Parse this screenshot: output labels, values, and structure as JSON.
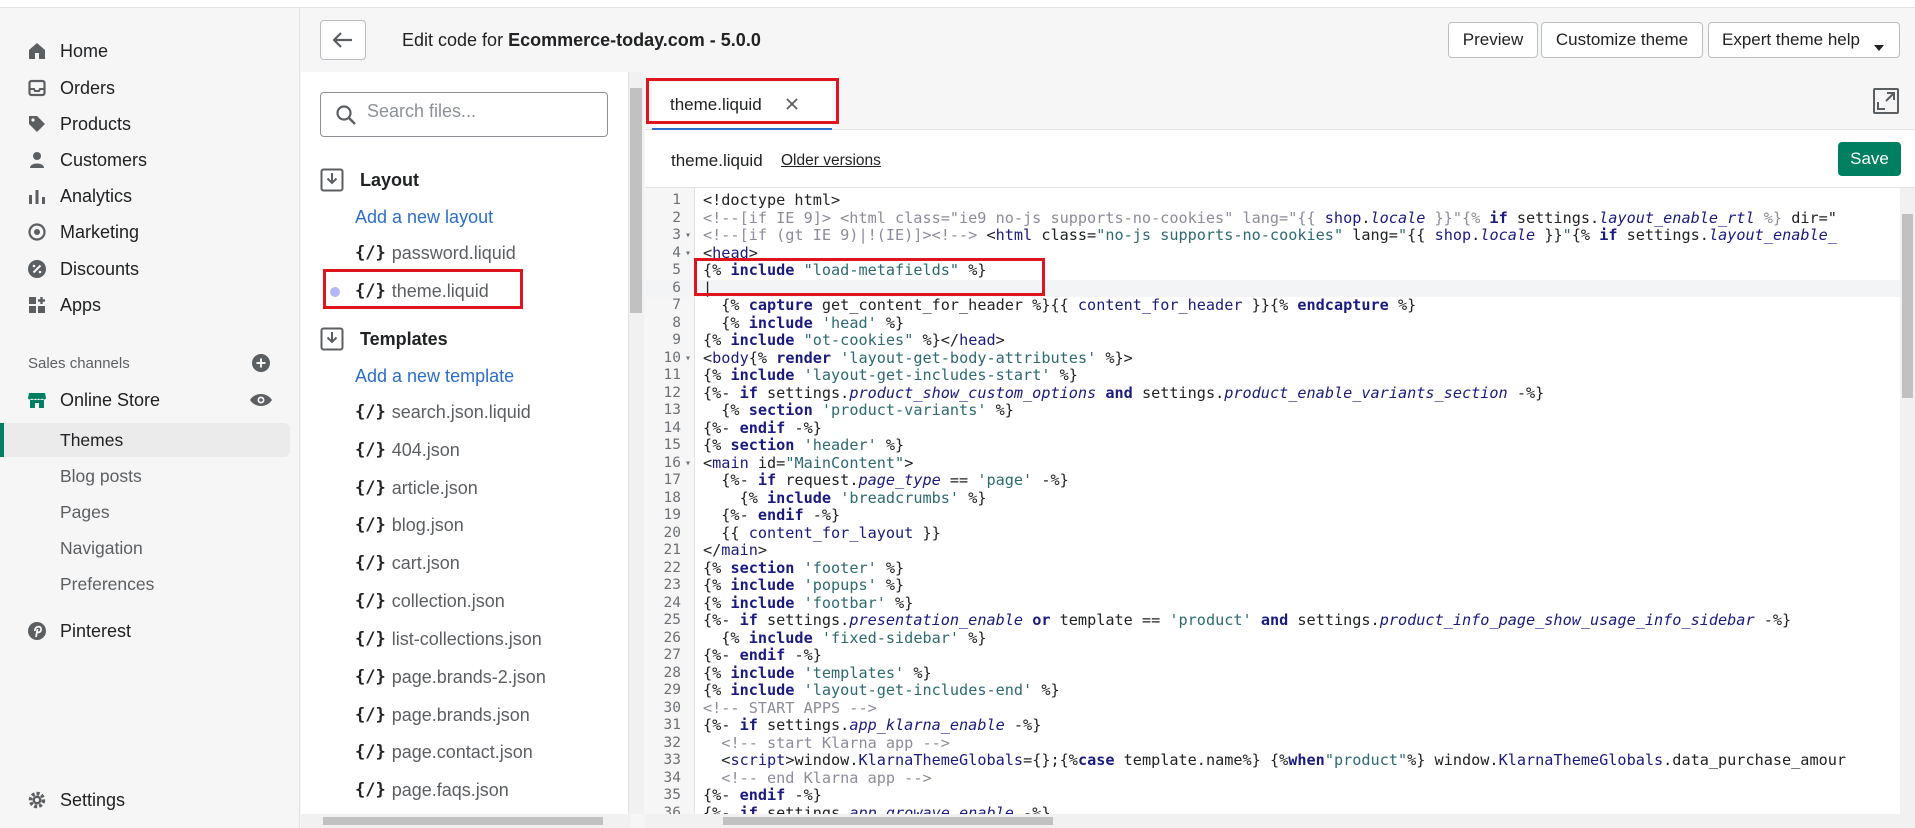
{
  "sidebar": {
    "items": [
      {
        "label": "Home",
        "icon": "home-icon"
      },
      {
        "label": "Orders",
        "icon": "orders-icon"
      },
      {
        "label": "Products",
        "icon": "tag-icon"
      },
      {
        "label": "Customers",
        "icon": "person-icon"
      },
      {
        "label": "Analytics",
        "icon": "bar-chart-icon"
      },
      {
        "label": "Marketing",
        "icon": "target-icon"
      },
      {
        "label": "Discounts",
        "icon": "discount-icon"
      },
      {
        "label": "Apps",
        "icon": "apps-icon"
      }
    ],
    "sales_channels_label": "Sales channels",
    "online_store": "Online Store",
    "subitems": [
      "Themes",
      "Blog posts",
      "Pages",
      "Navigation",
      "Preferences"
    ],
    "pinterest": "Pinterest",
    "settings": "Settings"
  },
  "header": {
    "title_prefix": "Edit code for ",
    "title_store": "Ecommerce-today.com - 5.0.0",
    "preview": "Preview",
    "customize": "Customize theme",
    "expert_help": "Expert theme help"
  },
  "files": {
    "search_placeholder": "Search files...",
    "layout_folder": "Layout",
    "add_layout": "Add a new layout",
    "layout_files": [
      "password.liquid",
      "theme.liquid"
    ],
    "templates_folder": "Templates",
    "add_template": "Add a new template",
    "template_files": [
      "search.json.liquid",
      "404.json",
      "article.json",
      "blog.json",
      "cart.json",
      "collection.json",
      "list-collections.json",
      "page.brands-2.json",
      "page.brands.json",
      "page.contact.json",
      "page.faqs.json"
    ]
  },
  "editor": {
    "tab_label": "theme.liquid",
    "file_name": "theme.liquid",
    "older_versions": "Older versions",
    "save": "Save"
  },
  "colors": {
    "accent_green": "#008060",
    "link_blue": "#2c6ecb",
    "highlight_red": "#e0141e"
  }
}
